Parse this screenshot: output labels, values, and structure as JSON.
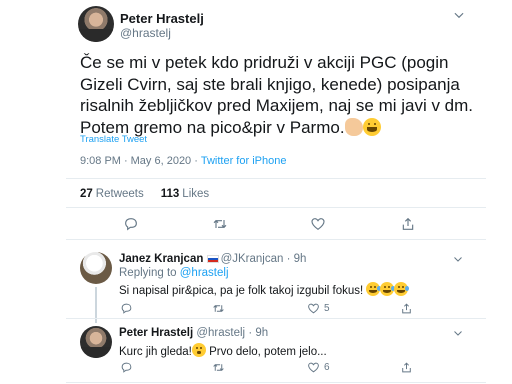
{
  "tweet": {
    "author_name": "Peter Hrastelj",
    "author_handle": "@hrastelj",
    "text": "Če se mi v petek kdo pridruži v akciji PGC (pogin Gizeli Cvirn, saj ste brali knjigo, kenede) posipanja risalnih žebljičkov pred Maxijem, naj se mi javi v dm. Potem gremo na pico&pir v Parmo.",
    "text_emojis": [
      "flexed-biceps-emoji",
      "grinning-face-emoji"
    ],
    "translate_label": "Translate Tweet",
    "time": "9:08 PM",
    "date": "May 6, 2020",
    "source": "Twitter for iPhone",
    "retweets_count": "27",
    "retweets_label": "Retweets",
    "likes_count": "113",
    "likes_label": "Likes"
  },
  "replies": [
    {
      "author_name": "Janez Kranjcan",
      "flag": "slovenia-flag-emoji",
      "author_handle": "@JKranjcan",
      "time_ago": "9h",
      "replying_to_label": "Replying to",
      "replying_to_handle": "@hrastelj",
      "text": "Si napisal pir&pica, pa je folk takoj izgubil fokus!",
      "emojis": [
        "tears-of-joy-emoji",
        "tears-of-joy-emoji",
        "tears-of-joy-emoji"
      ],
      "likes": "5"
    },
    {
      "author_name": "Peter Hrastelj",
      "author_handle": "@hrastelj",
      "time_ago": "9h",
      "text_before": "Kurc jih gleda!",
      "text_after": " Prvo delo, potem jelo...",
      "emojis": [
        "astonished-face-emoji"
      ],
      "likes": "6"
    }
  ],
  "separator": "·",
  "icons": [
    "reply-icon",
    "retweet-icon",
    "like-icon",
    "share-icon",
    "chevron-down-icon"
  ],
  "colors": {
    "link": "#1da1f2",
    "muted": "#657786",
    "text": "#14171a",
    "divider": "#e6ecf0"
  }
}
